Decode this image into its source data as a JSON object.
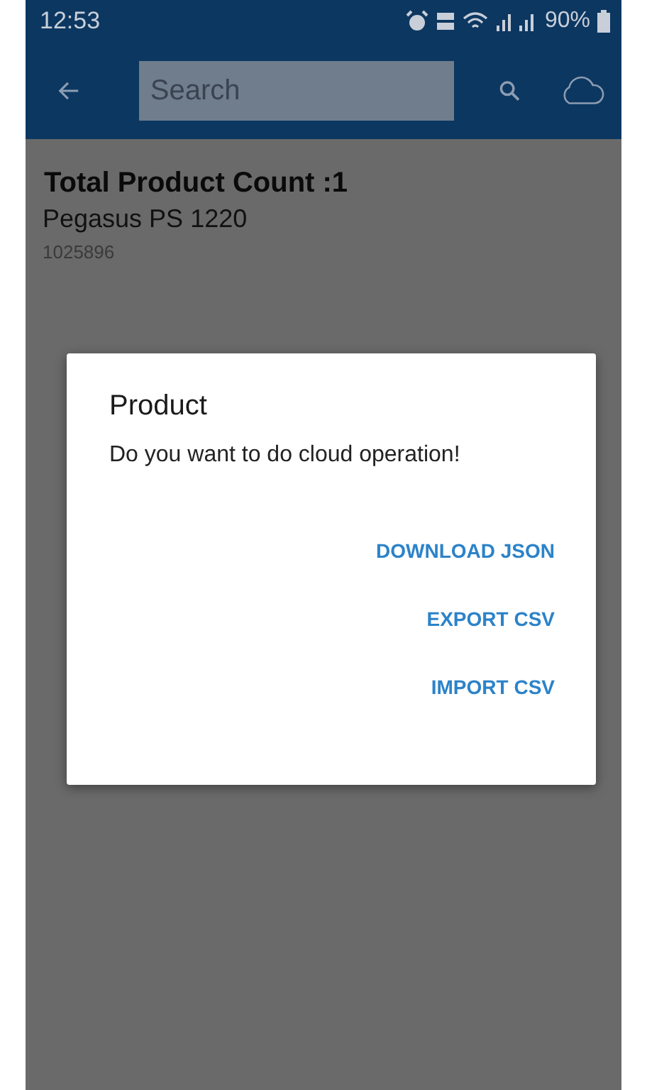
{
  "status_bar": {
    "time": "12:53",
    "battery": "90%"
  },
  "app_bar": {
    "search": {
      "placeholder": "Search"
    }
  },
  "summary": {
    "title": "Total Product Count :1"
  },
  "products": [
    {
      "name": "Pegasus PS 1220",
      "code": "1025896"
    }
  ],
  "dialog": {
    "title": "Product",
    "message": "Do you want to do cloud operation!",
    "actions": [
      "DOWNLOAD JSON",
      "EXPORT CSV",
      "IMPORT CSV"
    ]
  }
}
